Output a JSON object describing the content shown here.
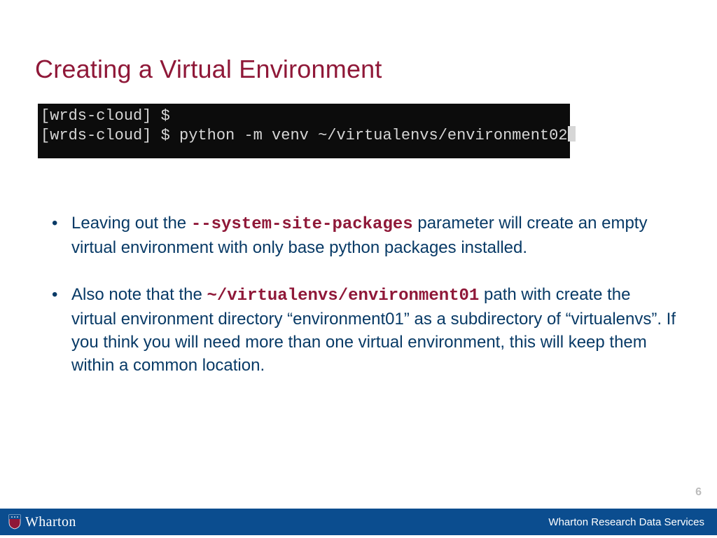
{
  "title": "Creating a Virtual Environment",
  "terminal": {
    "line1": "[wrds-cloud] $",
    "line2": "[wrds-cloud] $ python -m venv ~/virtualenvs/environment02"
  },
  "bullets": [
    {
      "pre": "Leaving out the ",
      "code": "--system-site-packages",
      "post": " parameter will create an empty virtual environment with only base python packages installed."
    },
    {
      "pre": "Also note that the ",
      "code": "~/virtualenvs/environment01",
      "post": " path with create the virtual environment directory “environment01” as a subdirectory of “virtualenvs”.  If you think you will need more than one virtual environment, this will keep them within a common location."
    }
  ],
  "page_number": "6",
  "footer": {
    "brand": "Wharton",
    "service": "Wharton Research Data Services"
  }
}
